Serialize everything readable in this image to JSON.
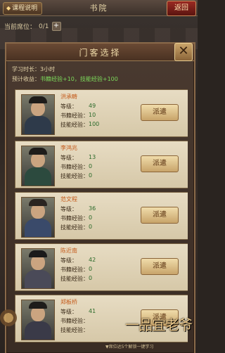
{
  "topbar": {
    "schedule_label": "课程说明",
    "title": "书院",
    "back_label": "返回"
  },
  "seat": {
    "label": "当前席位：",
    "value": "0/1"
  },
  "dialog": {
    "title": "门客选择",
    "close_label": "✕",
    "study_time_label": "学习时长：",
    "study_time_value": "3小时",
    "expected_label": "预计收益：",
    "expected_value": "书籍经验+10，技能经验+100"
  },
  "candidates": [
    {
      "name": "洪承畴",
      "level_label": "等级：",
      "level": "49",
      "book_label": "书籍经验：",
      "book": "10",
      "skill_label": "技能经验：",
      "skill": "100",
      "button": "派遣"
    },
    {
      "name": "李鸿兆",
      "level_label": "等级：",
      "level": "13",
      "book_label": "书籍经验：",
      "book": "0",
      "skill_label": "技能经验：",
      "skill": "0",
      "button": "派遣"
    },
    {
      "name": "范文程",
      "level_label": "等级：",
      "level": "36",
      "book_label": "书籍经验：",
      "book": "0",
      "skill_label": "技能经验：",
      "skill": "0",
      "button": "派遣"
    },
    {
      "name": "陈近南",
      "level_label": "等级：",
      "level": "42",
      "book_label": "书籍经验：",
      "book": "0",
      "skill_label": "技能经验：",
      "skill": "0",
      "button": "派遣"
    },
    {
      "name": "郑板桥",
      "level_label": "等级：",
      "level": "41",
      "book_label": "书籍经验：",
      "book": "",
      "skill_label": "技能经验：",
      "skill": "",
      "button": "派遣"
    }
  ],
  "footer": {
    "note": "▼席位达5个解锁一键学习",
    "logo": "一品宜老爷"
  },
  "colors": {
    "accent": "#c45a1a",
    "gain": "#7bd85a"
  }
}
